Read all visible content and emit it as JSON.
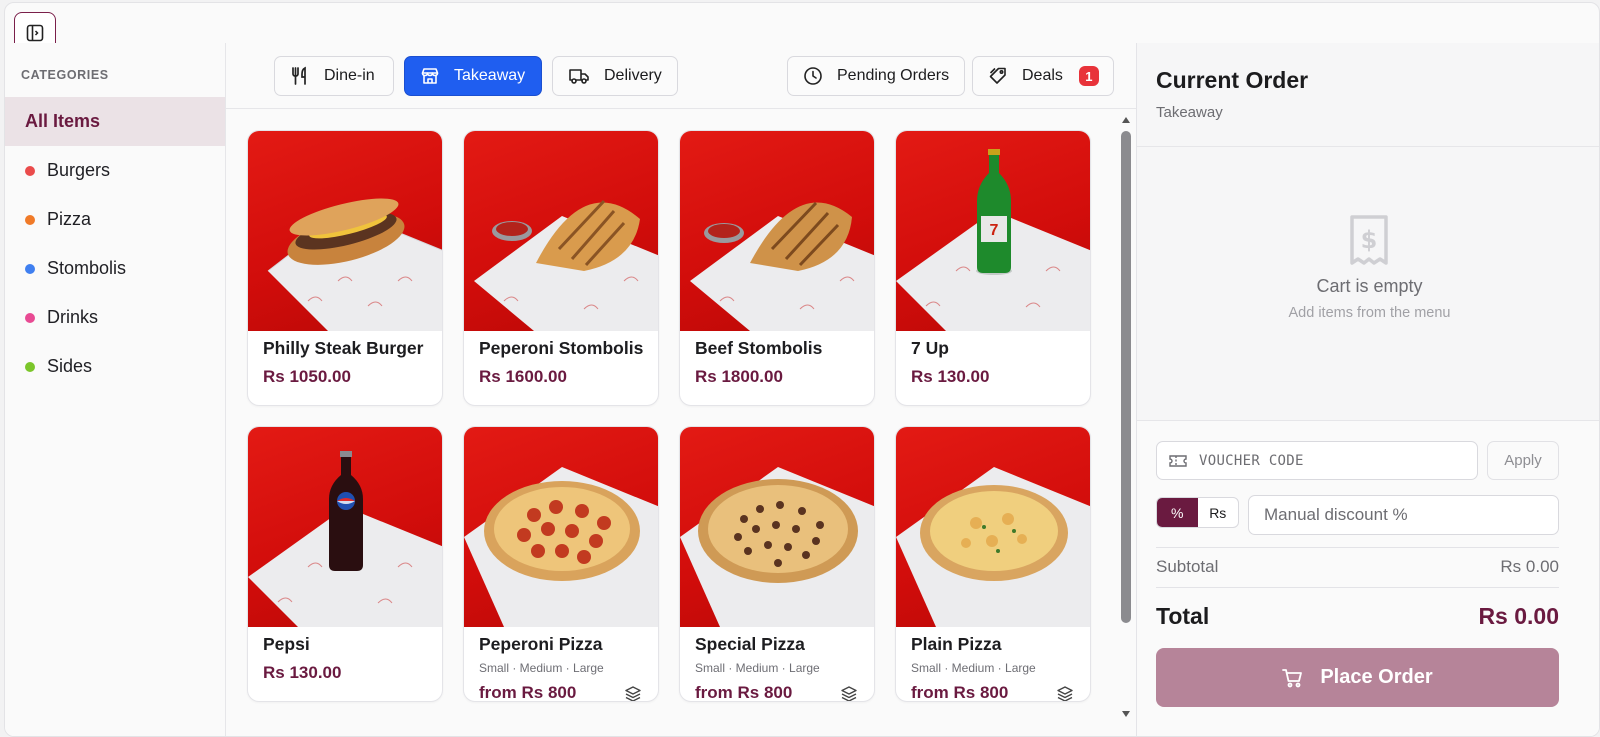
{
  "sidebar": {
    "toggle_icon": "sidebar-toggle-icon",
    "title": "CATEGORIES",
    "items": [
      {
        "label": "All Items",
        "dot": null
      },
      {
        "label": "Burgers",
        "dot": "#ea4b4b"
      },
      {
        "label": "Pizza",
        "dot": "#f07a28"
      },
      {
        "label": "Stombolis",
        "dot": "#3f7ff0"
      },
      {
        "label": "Drinks",
        "dot": "#e84a93"
      },
      {
        "label": "Sides",
        "dot": "#7bc62a"
      }
    ]
  },
  "modes": [
    {
      "label": "Dine-in",
      "icon": "utensils-icon"
    },
    {
      "label": "Takeaway",
      "icon": "store-icon"
    },
    {
      "label": "Delivery",
      "icon": "truck-icon"
    }
  ],
  "actions": {
    "pending_label": "Pending Orders",
    "pending_icon": "clock-icon",
    "deals_label": "Deals",
    "deals_icon": "tag-icon",
    "deals_count": "1"
  },
  "products": [
    {
      "name": "Philly Steak Burger",
      "price": "Rs 1050.00",
      "image": "sandwich"
    },
    {
      "name": "Peperoni Stombolis",
      "price": "Rs 1600.00",
      "image": "stromboli"
    },
    {
      "name": "Beef Stombolis",
      "price": "Rs 1800.00",
      "image": "stromboli"
    },
    {
      "name": "7 Up",
      "price": "Rs 130.00",
      "image": "green-bottle"
    },
    {
      "name": "Pepsi",
      "price": "Rs 130.00",
      "image": "dark-bottle"
    },
    {
      "name": "Peperoni Pizza",
      "sizes": "Small · Medium · Large",
      "price": "from Rs 800",
      "image": "pizza-pepperoni"
    },
    {
      "name": "Special Pizza",
      "sizes": "Small · Medium · Large",
      "price": "from Rs 800",
      "image": "pizza-special"
    },
    {
      "name": "Plain Pizza",
      "sizes": "Small · Medium · Large",
      "price": "from Rs 800",
      "image": "pizza-plain"
    }
  ],
  "order": {
    "title": "Current Order",
    "mode": "Takeaway",
    "empty_icon": "receipt-dollar-icon",
    "empty_title": "Cart is empty",
    "empty_sub": "Add items from the menu",
    "voucher_placeholder": "VOUCHER CODE",
    "apply_label": "Apply",
    "discount_types": [
      "%",
      "Rs"
    ],
    "manual_placeholder": "Manual discount %",
    "subtotal_label": "Subtotal",
    "subtotal_value": "Rs 0.00",
    "total_label": "Total",
    "total_value": "Rs 0.00",
    "place_label": "Place Order"
  },
  "colors": {
    "brand": "#6a1a40",
    "accent_blue": "#1f5ef0",
    "badge_red": "#e8333a"
  }
}
